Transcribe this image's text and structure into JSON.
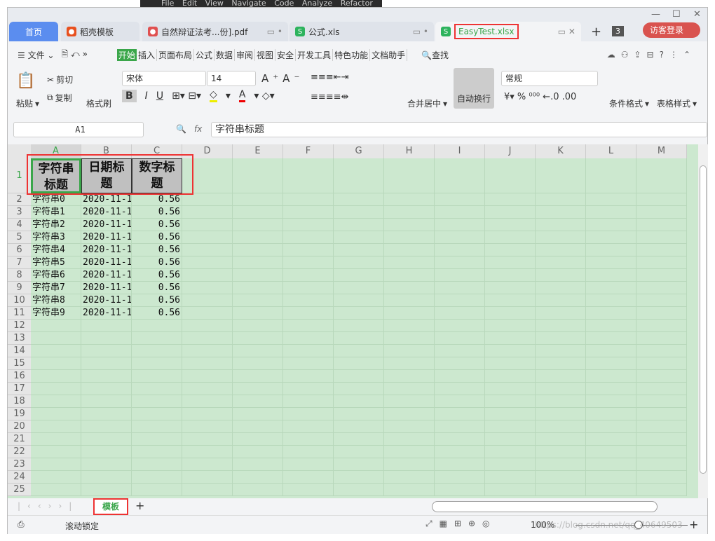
{
  "ide_menu": [
    "File",
    "Edit",
    "View",
    "Navigate",
    "Code",
    "Analyze",
    "Refactor"
  ],
  "tabs": [
    {
      "label": "首页",
      "type": "home"
    },
    {
      "label": "稻壳模板",
      "icon": "docer-icon",
      "color": "#e8501e"
    },
    {
      "label": "自然辩证法考...份].pdf",
      "icon": "pdf-icon",
      "color": "#e05050"
    },
    {
      "label": "公式.xls",
      "icon": "sheet-icon",
      "color": "#2db35d"
    },
    {
      "label": "EasyTest.xlsx",
      "icon": "sheet-icon",
      "color": "#2db35d",
      "active": true
    }
  ],
  "tab_count": "3",
  "login_label": "访客登录",
  "file_menu": "文件",
  "menu": [
    "开始",
    "插入",
    "页面布局",
    "公式",
    "数据",
    "审阅",
    "视图",
    "安全",
    "开发工具",
    "特色功能",
    "文档助手"
  ],
  "search_label": "查找",
  "toolbar": {
    "paste": "粘贴",
    "cut": "剪切",
    "copy": "复制",
    "format_painter": "格式刷",
    "font": "宋体",
    "size": "14",
    "merge": "合并居中",
    "wrap": "自动换行",
    "number_format": "常规",
    "cond_format": "条件格式",
    "table_style": "表格样式"
  },
  "formula": {
    "name_box": "A1",
    "fx": "fx",
    "value": "字符串标题"
  },
  "columns": [
    "A",
    "B",
    "C",
    "D",
    "E",
    "F",
    "G",
    "H",
    "I",
    "J",
    "K",
    "L",
    "M"
  ],
  "header_row": [
    "字符串标题",
    "日期标题",
    "数字标题"
  ],
  "rows": [
    [
      "字符串0",
      "2020-11-1",
      "0.56"
    ],
    [
      "字符串1",
      "2020-11-1",
      "0.56"
    ],
    [
      "字符串2",
      "2020-11-1",
      "0.56"
    ],
    [
      "字符串3",
      "2020-11-1",
      "0.56"
    ],
    [
      "字符串4",
      "2020-11-1",
      "0.56"
    ],
    [
      "字符串5",
      "2020-11-1",
      "0.56"
    ],
    [
      "字符串6",
      "2020-11-1",
      "0.56"
    ],
    [
      "字符串7",
      "2020-11-1",
      "0.56"
    ],
    [
      "字符串8",
      "2020-11-1",
      "0.56"
    ],
    [
      "字符串9",
      "2020-11-1",
      "0.56"
    ]
  ],
  "row_count": 25,
  "sheet_tab": "模板",
  "status": {
    "scroll_lock": "滚动锁定",
    "zoom": "100%",
    "watermark": "https://blog.csdn.net/qq_40649503"
  },
  "colors": {
    "accent": "#3aa64a",
    "grid_bg": "#cce8cf",
    "highlight": "#e33333"
  }
}
